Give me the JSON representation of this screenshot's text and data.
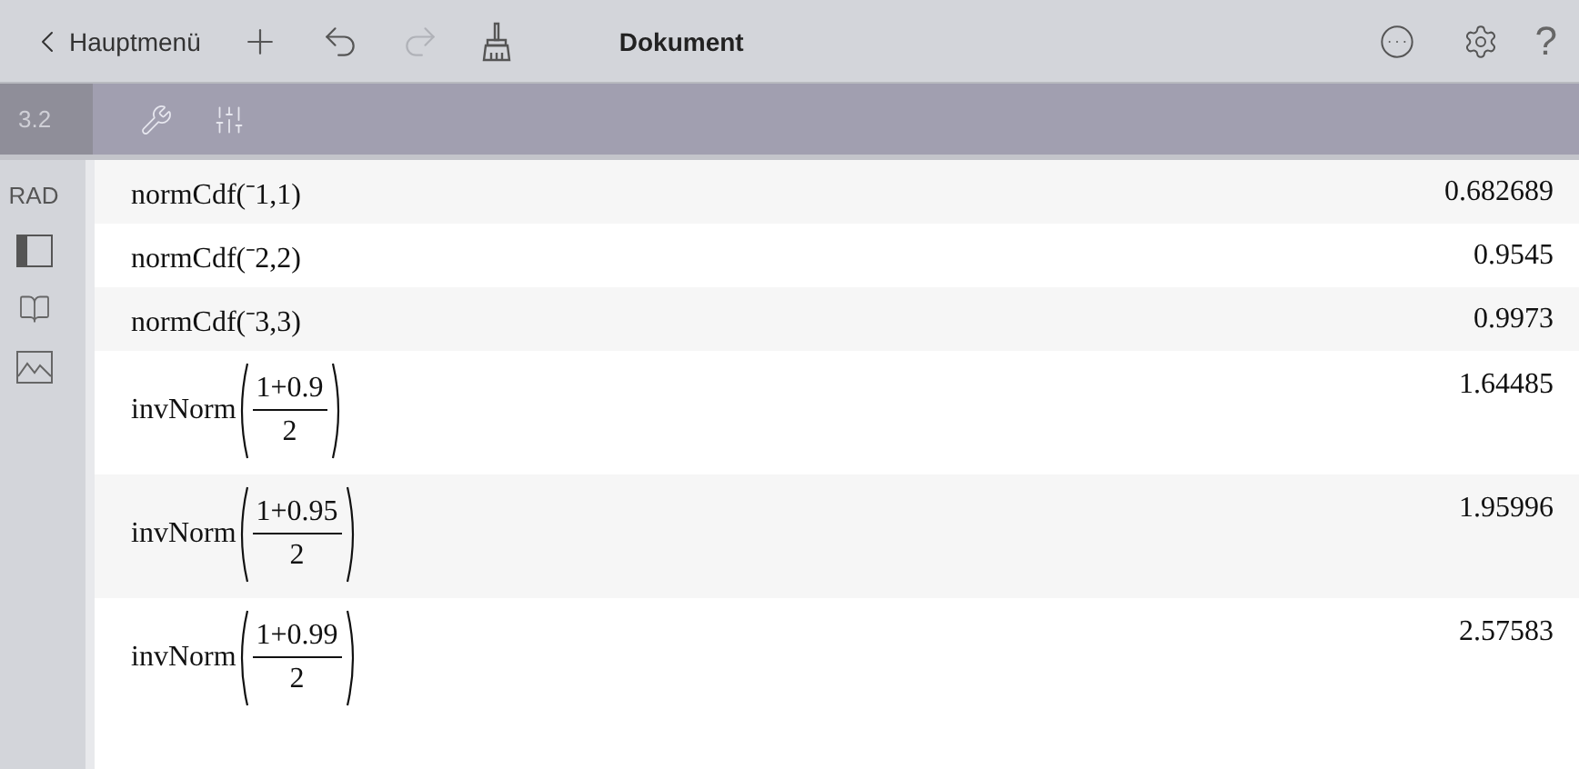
{
  "top_bar": {
    "back_label": "Hauptmenü",
    "title": "Dokument",
    "help_label": "?",
    "actions": [
      {
        "kind": "add",
        "disabled": false
      },
      {
        "kind": "undo",
        "disabled": false
      },
      {
        "kind": "redo",
        "disabled": true
      },
      {
        "kind": "clear",
        "disabled": false
      }
    ]
  },
  "page_bar": {
    "page": "3.2"
  },
  "sidebar": {
    "mode": "RAD",
    "items": [
      {
        "kind": "layout"
      },
      {
        "kind": "book"
      },
      {
        "kind": "graph"
      }
    ]
  },
  "history": [
    {
      "kind": "call",
      "text": "normCdf(⁻1,1)",
      "result": "0.682689"
    },
    {
      "kind": "call",
      "text": "normCdf(⁻2,2)",
      "result": "0.9545"
    },
    {
      "kind": "call",
      "text": "normCdf(⁻3,3)",
      "result": "0.9973"
    },
    {
      "kind": "fraction",
      "func": "invNorm",
      "numerator": "1+0.9",
      "denominator": "2",
      "result": "1.64485"
    },
    {
      "kind": "fraction",
      "func": "invNorm",
      "numerator": "1+0.95",
      "denominator": "2",
      "result": "1.95996"
    },
    {
      "kind": "fraction",
      "func": "invNorm",
      "numerator": "1+0.99",
      "denominator": "2",
      "result": "2.57583"
    }
  ]
}
